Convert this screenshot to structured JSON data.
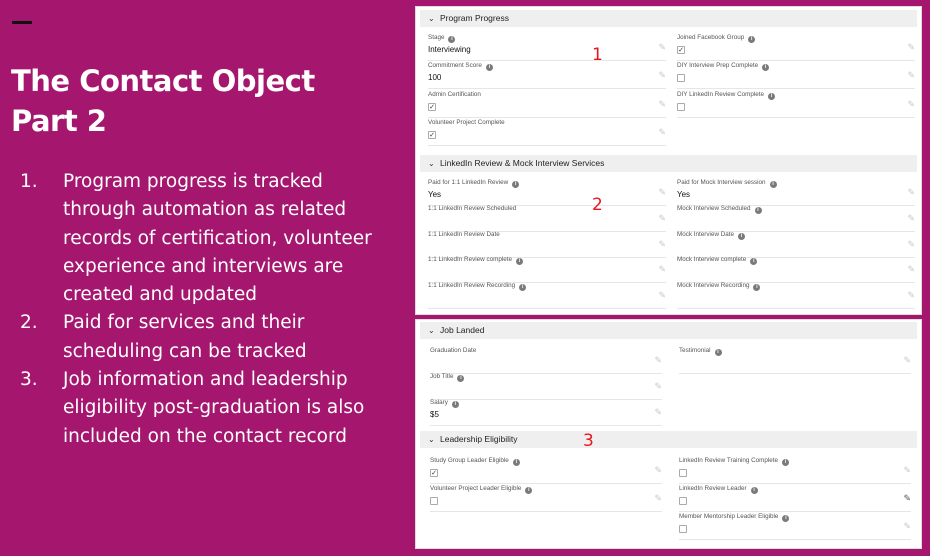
{
  "slide": {
    "title_line1": "The Contact Object",
    "title_line2": "Part 2",
    "points": [
      {
        "num": "1.",
        "text": "Program progress is tracked through automation as related records of certification, volunteer experience and interviews are created and updated"
      },
      {
        "num": "2.",
        "text": "Paid for services and their scheduling can be tracked"
      },
      {
        "num": "3.",
        "text": "Job information and leadership eligibility post-graduation is also included on the contact record"
      }
    ]
  },
  "markers": {
    "one": "1",
    "two": "2",
    "three": "3"
  },
  "icons": {
    "section_toggle": "chevron-down-icon",
    "edit": "pencil-icon",
    "help": "info-icon"
  },
  "program_progress": {
    "header": "Program Progress",
    "fields": {
      "stage": {
        "label": "Stage",
        "value": "Interviewing"
      },
      "commitment_score": {
        "label": "Commitment Score",
        "value": "100"
      },
      "admin_cert": {
        "label": "Admin Certification",
        "checked": true
      },
      "volunteer_complete": {
        "label": "Volunteer Project Complete",
        "checked": true
      },
      "joined_fb": {
        "label": "Joined Facebook Group",
        "checked": true
      },
      "diy_interview": {
        "label": "DIY Interview Prep Complete",
        "checked": false
      },
      "diy_linkedin": {
        "label": "DIY LinkedIn Review Complete",
        "checked": false
      }
    }
  },
  "linkedin_review": {
    "header": "LinkedIn Review & Mock Interview Services",
    "fields": {
      "paid_linkedin": {
        "label": "Paid for 1:1 LinkedIn Review",
        "value": "Yes"
      },
      "li_scheduled": {
        "label": "1:1 LinkedIn Review Scheduled",
        "value": ""
      },
      "li_date": {
        "label": "1:1 LinkedIn Review Date",
        "value": ""
      },
      "li_complete": {
        "label": "1:1 LinkedIn Review complete",
        "value": ""
      },
      "li_recording": {
        "label": "1:1 LinkedIn Review Recording",
        "value": ""
      },
      "paid_mock": {
        "label": "Paid for Mock Interview session",
        "value": "Yes"
      },
      "mock_scheduled": {
        "label": "Mock Interview Scheduled",
        "value": ""
      },
      "mock_date": {
        "label": "Mock Interview Date",
        "value": ""
      },
      "mock_complete": {
        "label": "Mock Interview complete",
        "value": ""
      },
      "mock_recording": {
        "label": "Mock Interview Recording",
        "value": ""
      }
    }
  },
  "job_landed": {
    "header": "Job Landed",
    "fields": {
      "grad_date": {
        "label": "Graduation Date",
        "value": ""
      },
      "job_title": {
        "label": "Job Title",
        "value": ""
      },
      "salary": {
        "label": "Salary",
        "value": "$5"
      },
      "testimonial": {
        "label": "Testimonial",
        "value": ""
      }
    }
  },
  "leadership": {
    "header": "Leadership Eligibility",
    "fields": {
      "study_group": {
        "label": "Study Group Leader Eligible",
        "checked": true
      },
      "volunteer_leader": {
        "label": "Volunteer Project Leader Eligible",
        "checked": false
      },
      "li_training": {
        "label": "LinkedIn Review Training Complete",
        "checked": false
      },
      "li_leader": {
        "label": "LinkedIn Review Leader",
        "checked": false
      },
      "mentorship": {
        "label": "Member Mentorship Leader Eligible",
        "checked": false
      }
    }
  }
}
